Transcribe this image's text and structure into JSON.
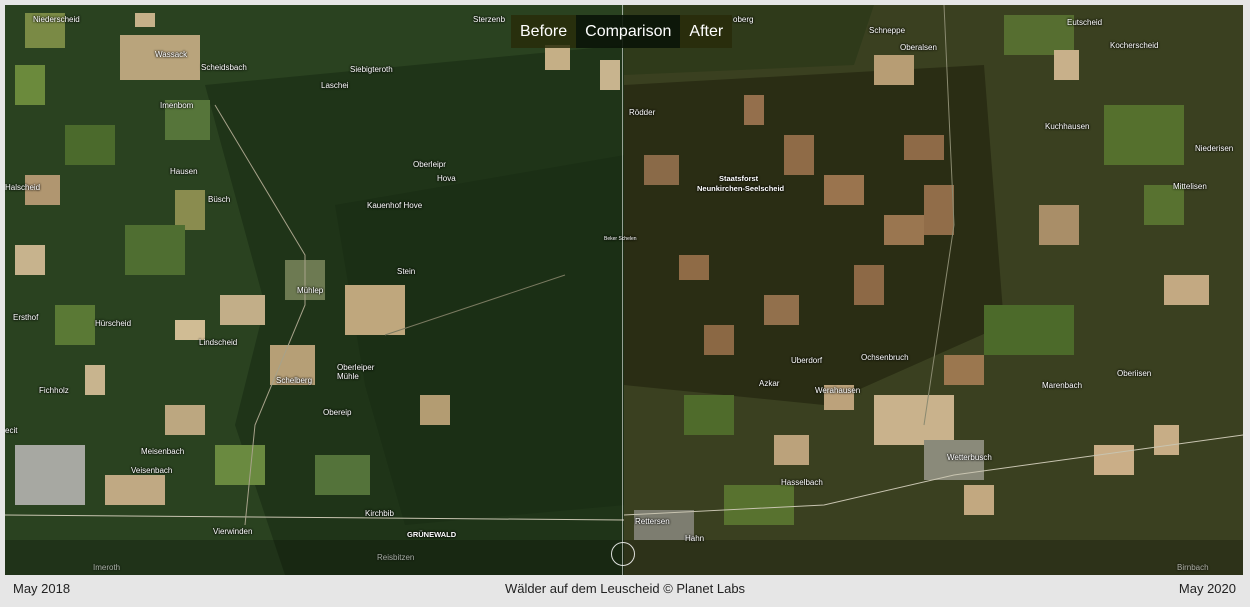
{
  "toolbar": {
    "before_label": "Before",
    "comparison_label": "Comparison",
    "after_label": "After",
    "active": "comparison"
  },
  "caption": {
    "left_date": "May 2018",
    "center": "Wälder auf dem Leuscheid © Planet Labs",
    "right_date": "May 2020"
  },
  "map_labels": [
    "Niederscheid",
    "Wassack",
    "Scheidsbach",
    "Siebigteroth",
    "Sterzenb",
    "Laschei",
    "Imenbom",
    "Oberleipr",
    "Hova",
    "Hausen",
    "Büsch",
    "Kauenhof Hove",
    "Stein",
    "Mühlep",
    "Hürscheid",
    "Lindscheid",
    "Oberleiper Mühle",
    "Schelberg",
    "Obereip",
    "Meisenbach",
    "Veisenbach",
    "Vierwinden",
    "Kirchbib",
    "GRÜNEWALD",
    "Reisbitzen",
    "Fichholz",
    "Halscheid",
    "Ersthof",
    "ecit",
    "Imeroth",
    "oberg",
    "Schneppe",
    "Oberalsen",
    "Eutscheid",
    "Kocherscheid",
    "Rödder",
    "Kuchhausen",
    "Niederisen",
    "Staatsforst",
    "Neunkirchen-Seelscheid",
    "Mittelisen",
    "Beker Schelen",
    "Uberdorf",
    "Ochsenbruch",
    "Azkar",
    "Werahausen",
    "Marenbach",
    "Oberiisen",
    "Wetterbusch",
    "Hasselbach",
    "Rettersen",
    "Hahn",
    "Birnbach"
  ],
  "colors": {
    "forest_before": "#233a1b",
    "forest_after": "#2b2e16",
    "field_light": "#b9a076",
    "field_green": "#4d6a2d"
  }
}
